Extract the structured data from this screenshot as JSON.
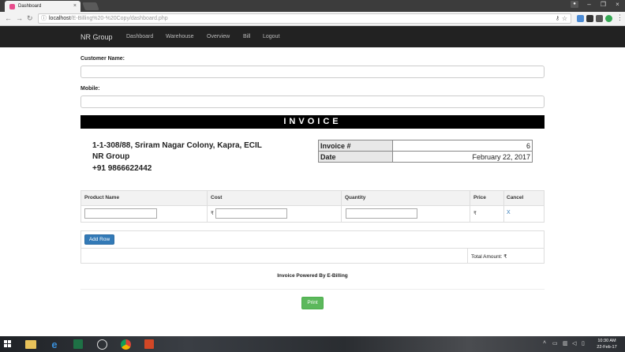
{
  "browser": {
    "tab_title": "Dashboard",
    "url_host": "localhost",
    "url_path": "/E-Billing%20-%20Copy/dashboard.php"
  },
  "navbar": {
    "brand": "NR Group",
    "links": [
      "Dashboard",
      "Warehouse",
      "Overview",
      "Bill",
      "Logout"
    ]
  },
  "form": {
    "customer_label": "Customer Name:",
    "customer_value": "",
    "mobile_label": "Mobile:",
    "mobile_value": ""
  },
  "invoice": {
    "heading": "INVOICE",
    "address_lines": [
      "1-1-308/88, Sriram Nagar Colony, Kapra, ECIL",
      "NR Group",
      "+91 9866622442"
    ],
    "meta": [
      {
        "key": "Invoice #",
        "value": "6"
      },
      {
        "key": "Date",
        "value": "February 22, 2017"
      }
    ]
  },
  "products": {
    "headers": [
      "Product Name",
      "Cost",
      "Quantity",
      "Price",
      "Cancel"
    ],
    "currency_symbol": "₹",
    "cancel_label": "X"
  },
  "actions": {
    "add_row": "Add Row",
    "total_label": "Total Amount: ₹",
    "powered_by": "Invoice Powered By E-Billing",
    "print": "Print"
  },
  "taskbar": {
    "time": "10:30 AM",
    "date": "22-Feb-17"
  },
  "colors": {
    "navbar_bg": "#222222",
    "primary_button": "#337ab7",
    "success_button": "#5cb85c",
    "link": "#337ab7"
  }
}
